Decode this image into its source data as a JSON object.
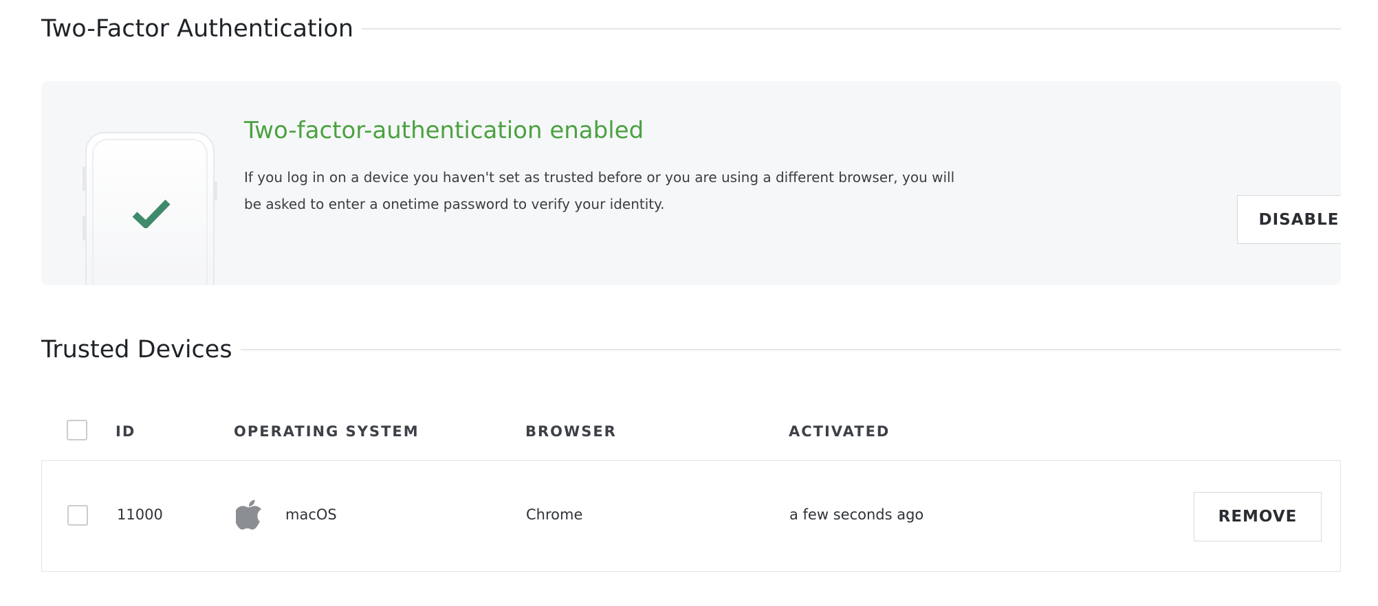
{
  "two_factor": {
    "section_title": "Two-Factor Authentication",
    "status_title": "Two-factor-authentication enabled",
    "description": "If you log in on a device you haven't set as trusted before or you are using a different browser, you will be asked to enter a onetime password to verify your identity.",
    "disable_label": "DISABLE",
    "status_color": "#4aa23f",
    "check_color": "#3f8a6b",
    "icon": "check-icon"
  },
  "trusted_devices": {
    "section_title": "Trusted Devices",
    "columns": {
      "id": "ID",
      "os": "OPERATING SYSTEM",
      "browser": "BROWSER",
      "activated": "ACTIVATED"
    },
    "rows": [
      {
        "id": "11000",
        "os_icon": "apple-icon",
        "os": "macOS",
        "browser": "Chrome",
        "activated": "a few seconds ago",
        "remove_label": "REMOVE"
      }
    ]
  }
}
